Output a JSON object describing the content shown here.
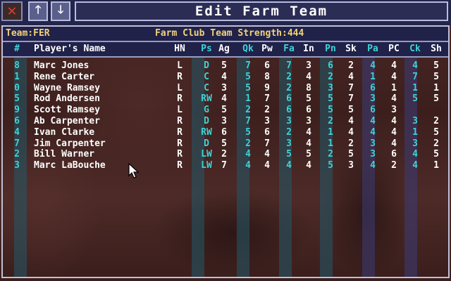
{
  "window": {
    "title": "Edit Farm Team",
    "close_icon": "close-icon",
    "up_icon": "arrow-up-icon",
    "down_icon": "arrow-down-icon"
  },
  "info": {
    "team_label": "Team:FER",
    "strength_label": "Farm Club Team Strength:",
    "strength_value": "444"
  },
  "columns": [
    "#",
    "Player's Name",
    "HN",
    "Ps",
    "Ag",
    "Qk",
    "Pw",
    "Fa",
    "In",
    "Pn",
    "Sk",
    "Pa",
    "PC",
    "Ck",
    "Sh"
  ],
  "rows": [
    [
      "8",
      "Marc Jones",
      "L",
      "D",
      "5",
      "7",
      "6",
      "7",
      "3",
      "6",
      "2",
      "4",
      "4",
      "4",
      "5"
    ],
    [
      "1",
      "Rene Carter",
      "R",
      "C",
      "4",
      "5",
      "8",
      "2",
      "4",
      "2",
      "4",
      "1",
      "4",
      "7",
      "5"
    ],
    [
      "0",
      "Wayne Ramsey",
      "L",
      "C",
      "3",
      "5",
      "9",
      "2",
      "8",
      "3",
      "7",
      "6",
      "1",
      "1",
      "1"
    ],
    [
      "5",
      "Rod Andersen",
      "R",
      "RW",
      "4",
      "1",
      "7",
      "6",
      "5",
      "5",
      "7",
      "3",
      "4",
      "5",
      "5"
    ],
    [
      "9",
      "Scott Ramsey",
      "L",
      "G",
      "5",
      "2",
      "2",
      "6",
      "6",
      "5",
      "5",
      "6",
      "3",
      "",
      ""
    ],
    [
      "6",
      "Ab Carpenter",
      "R",
      "D",
      "3",
      "7",
      "3",
      "3",
      "3",
      "2",
      "4",
      "4",
      "4",
      "3",
      "2"
    ],
    [
      "4",
      "Ivan Clarke",
      "R",
      "RW",
      "6",
      "5",
      "6",
      "2",
      "4",
      "1",
      "4",
      "4",
      "4",
      "1",
      "5"
    ],
    [
      "7",
      "Jim Carpenter",
      "R",
      "D",
      "5",
      "2",
      "7",
      "3",
      "4",
      "1",
      "2",
      "3",
      "4",
      "3",
      "2"
    ],
    [
      "2",
      "Bill Warner",
      "R",
      "LW",
      "2",
      "4",
      "4",
      "5",
      "5",
      "2",
      "5",
      "3",
      "6",
      "4",
      "5"
    ],
    [
      "3",
      "Marc LaBouche",
      "R",
      "LW",
      "7",
      "4",
      "4",
      "4",
      "4",
      "5",
      "3",
      "4",
      "2",
      "4",
      "1"
    ]
  ],
  "colors": {
    "cyan": "#3fd2d6",
    "white": "#ffffff",
    "gold": "#f2d27a",
    "bar_bg": "#20224a"
  }
}
